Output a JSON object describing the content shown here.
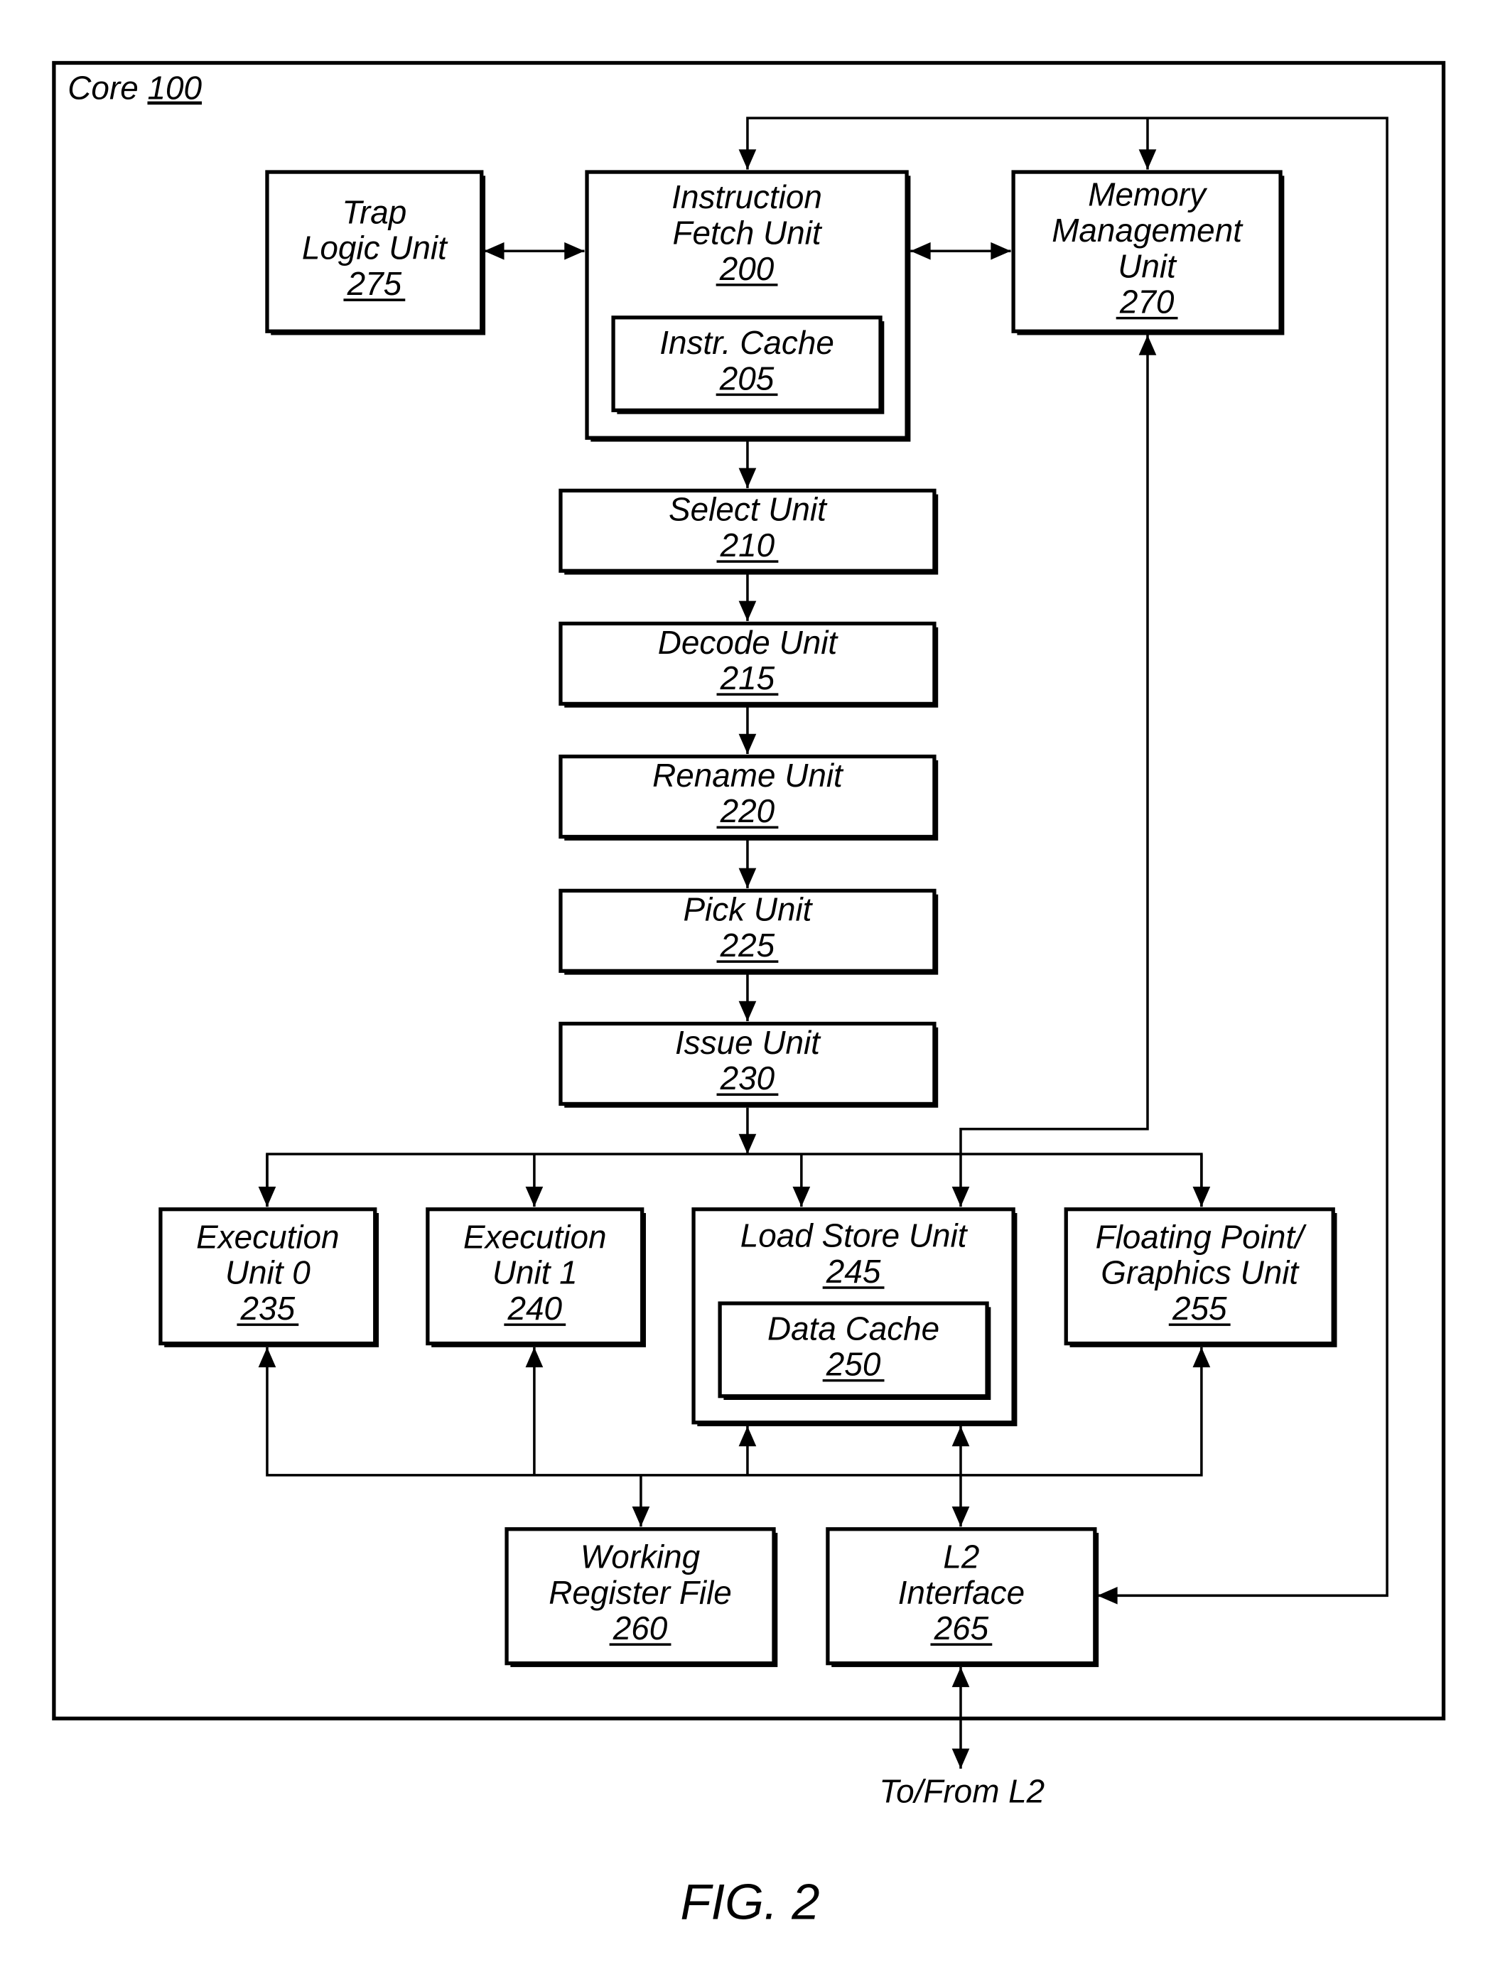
{
  "figure": {
    "title": "FIG. 2",
    "container": {
      "label": "Core",
      "ref": "100"
    },
    "external_label": "To/From L2",
    "colors": {
      "line": "#000000",
      "background": "#ffffff"
    },
    "blocks": {
      "trap": {
        "lines": [
          "Trap",
          "Logic Unit"
        ],
        "ref": "275"
      },
      "ifu": {
        "lines": [
          "Instruction",
          "Fetch Unit"
        ],
        "ref": "200"
      },
      "icache": {
        "lines": [
          "Instr. Cache"
        ],
        "ref": "205"
      },
      "mmu": {
        "lines": [
          "Memory",
          "Management",
          "Unit"
        ],
        "ref": "270"
      },
      "select": {
        "lines": [
          "Select Unit"
        ],
        "ref": "210"
      },
      "decode": {
        "lines": [
          "Decode Unit"
        ],
        "ref": "215"
      },
      "rename": {
        "lines": [
          "Rename Unit"
        ],
        "ref": "220"
      },
      "pick": {
        "lines": [
          "Pick Unit"
        ],
        "ref": "225"
      },
      "issue": {
        "lines": [
          "Issue Unit"
        ],
        "ref": "230"
      },
      "exu0": {
        "lines": [
          "Execution",
          "Unit 0"
        ],
        "ref": "235"
      },
      "exu1": {
        "lines": [
          "Execution",
          "Unit 1"
        ],
        "ref": "240"
      },
      "lsu": {
        "lines": [
          "Load Store Unit"
        ],
        "ref": "245"
      },
      "dcache": {
        "lines": [
          "Data Cache"
        ],
        "ref": "250"
      },
      "fgu": {
        "lines": [
          "Floating Point/",
          "Graphics Unit"
        ],
        "ref": "255"
      },
      "wrf": {
        "lines": [
          "Working",
          "Register File"
        ],
        "ref": "260"
      },
      "l2": {
        "lines": [
          "L2",
          "Interface"
        ],
        "ref": "265"
      }
    },
    "connections": [
      {
        "from": "trap",
        "to": "ifu",
        "type": "bidirectional"
      },
      {
        "from": "ifu",
        "to": "mmu",
        "type": "bidirectional"
      },
      {
        "from": "l2",
        "to": "ifu",
        "type": "directed"
      },
      {
        "from": "l2",
        "to": "mmu",
        "type": "directed"
      },
      {
        "from": "ifu",
        "to": "select",
        "type": "directed"
      },
      {
        "from": "select",
        "to": "decode",
        "type": "directed"
      },
      {
        "from": "decode",
        "to": "rename",
        "type": "directed"
      },
      {
        "from": "rename",
        "to": "pick",
        "type": "directed"
      },
      {
        "from": "pick",
        "to": "issue",
        "type": "directed"
      },
      {
        "from": "issue",
        "to": "exu0",
        "type": "directed"
      },
      {
        "from": "issue",
        "to": "exu1",
        "type": "directed"
      },
      {
        "from": "issue",
        "to": "lsu",
        "type": "directed"
      },
      {
        "from": "issue",
        "to": "fgu",
        "type": "directed"
      },
      {
        "from": "lsu",
        "to": "mmu",
        "type": "directed"
      },
      {
        "from": "wrf",
        "to": "exu0",
        "type": "directed"
      },
      {
        "from": "wrf",
        "to": "exu1",
        "type": "directed"
      },
      {
        "from": "wrf",
        "to": "lsu",
        "type": "directed"
      },
      {
        "from": "wrf",
        "to": "fgu",
        "type": "directed"
      },
      {
        "from": "lsu",
        "to": "l2",
        "type": "bidirectional"
      },
      {
        "from": "mmu",
        "to": "l2",
        "type": "directed"
      },
      {
        "from": "l2",
        "to": "external",
        "type": "bidirectional"
      }
    ]
  }
}
